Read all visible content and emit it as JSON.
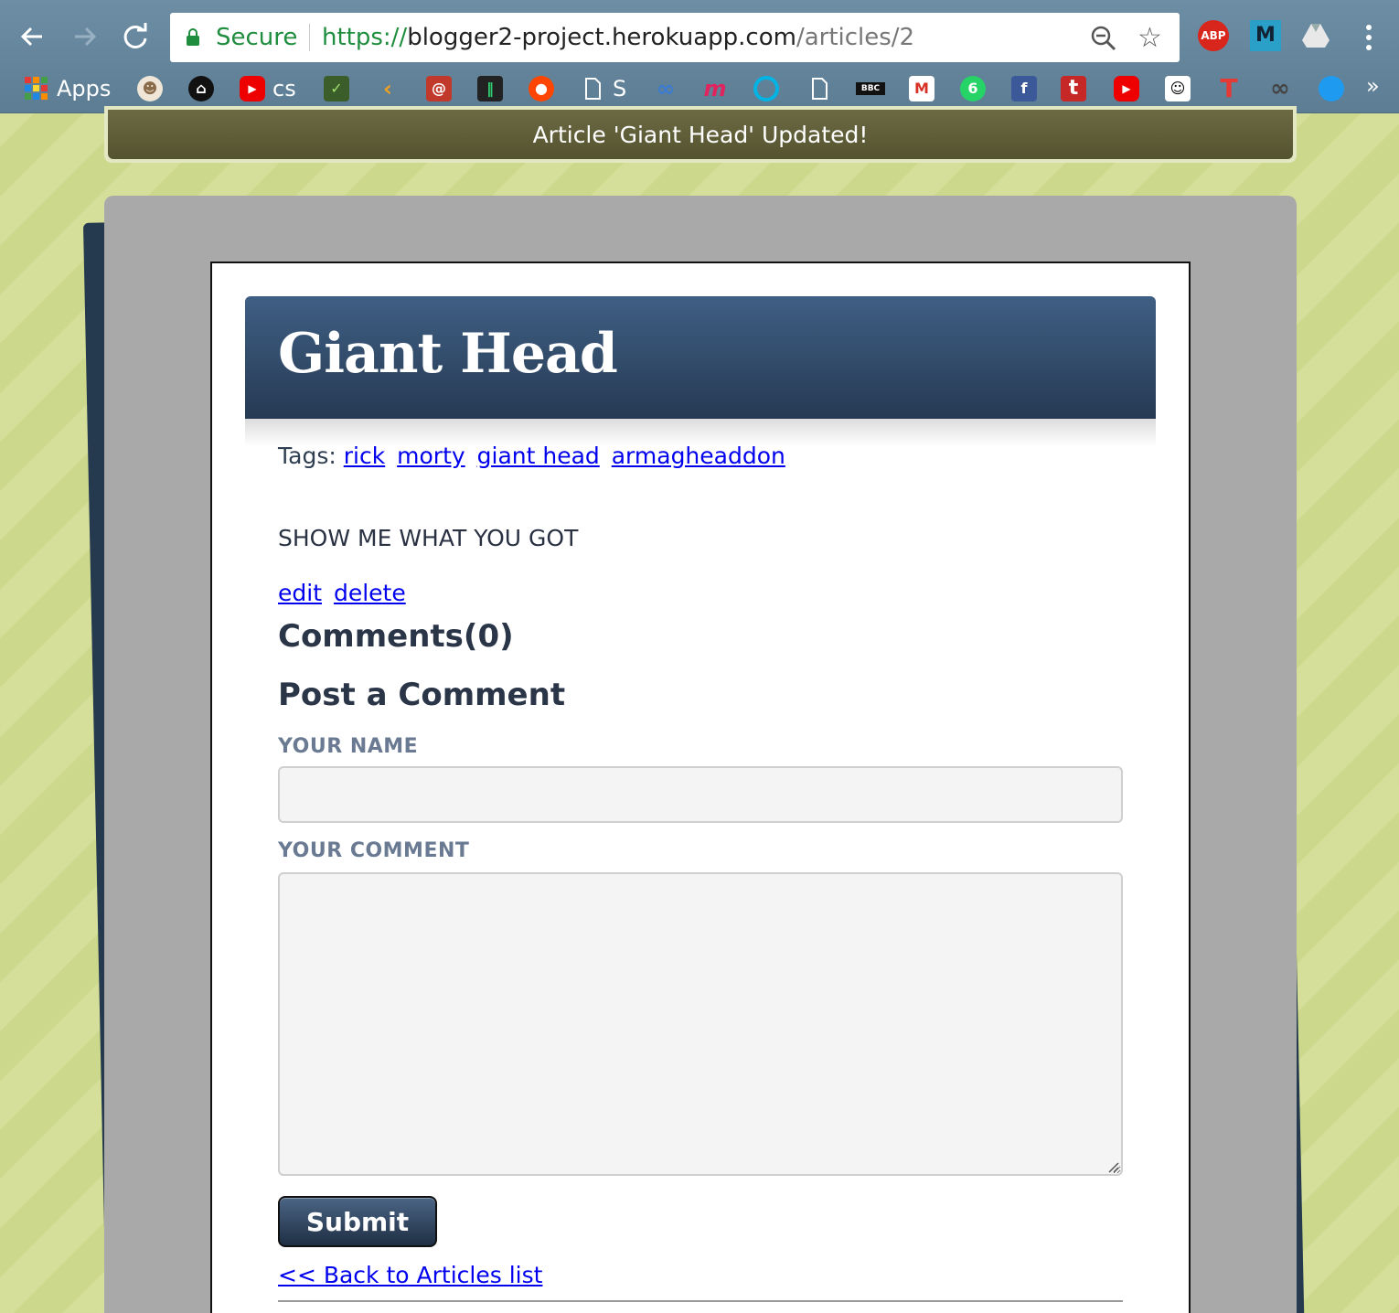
{
  "browser": {
    "secure_label": "Secure",
    "url_scheme": "https://",
    "url_host": "blogger2-project.herokuapp.com",
    "url_path": "/articles/2",
    "extensions": {
      "abp_label": "ABP",
      "m_label": "M"
    },
    "bookmarks": [
      {
        "label": "Apps",
        "icon": "apps-grid-icon"
      },
      {
        "label": "",
        "icon": "viking-icon"
      },
      {
        "label": "",
        "icon": "github-icon"
      },
      {
        "label": "cs",
        "icon": "youtube-icon"
      },
      {
        "label": "",
        "icon": "gauge-icon"
      },
      {
        "label": "",
        "icon": "leetcode-icon"
      },
      {
        "label": "",
        "icon": "spiral-icon"
      },
      {
        "label": "",
        "icon": "bars-icon"
      },
      {
        "label": "",
        "icon": "reddit-icon"
      },
      {
        "label": "S",
        "icon": "page-icon"
      },
      {
        "label": "",
        "icon": "infinity-icon"
      },
      {
        "label": "",
        "icon": "m-logo-icon"
      },
      {
        "label": "",
        "icon": "circle-icon"
      },
      {
        "label": "",
        "icon": "page-icon"
      },
      {
        "label": "",
        "icon": "bbc-icon"
      },
      {
        "label": "",
        "icon": "gmail-icon"
      },
      {
        "label": "",
        "icon": "whatsapp-icon"
      },
      {
        "label": "",
        "icon": "facebook-icon"
      },
      {
        "label": "",
        "icon": "tumblr-icon"
      },
      {
        "label": "",
        "icon": "youtube-icon"
      },
      {
        "label": "",
        "icon": "people-icon"
      },
      {
        "label": "",
        "icon": "t-icon"
      },
      {
        "label": "",
        "icon": "glasses-icon"
      },
      {
        "label": "",
        "icon": "blue-circle-icon"
      }
    ],
    "more_label": "»"
  },
  "flash": {
    "message": "Article 'Giant Head' Updated!"
  },
  "article": {
    "title": "Giant Head",
    "tags_label": "Tags:",
    "tags": [
      "rick",
      "morty",
      "giant head",
      "armagheaddon"
    ],
    "body": "SHOW ME WHAT YOU GOT",
    "edit_label": "edit",
    "delete_label": "delete"
  },
  "comments": {
    "heading": "Comments(0)",
    "post_heading": "Post a Comment",
    "name_label": "YOUR NAME",
    "name_value": "",
    "comment_label": "YOUR COMMENT",
    "comment_value": "",
    "submit_label": "Submit"
  },
  "footer": {
    "back_link": "<< Back to Articles list"
  },
  "colors": {
    "title_bar": "#2f4a6a",
    "link": "#0000ee",
    "flash_bg": "#5f5e39",
    "page_bg": "#d6df99"
  }
}
